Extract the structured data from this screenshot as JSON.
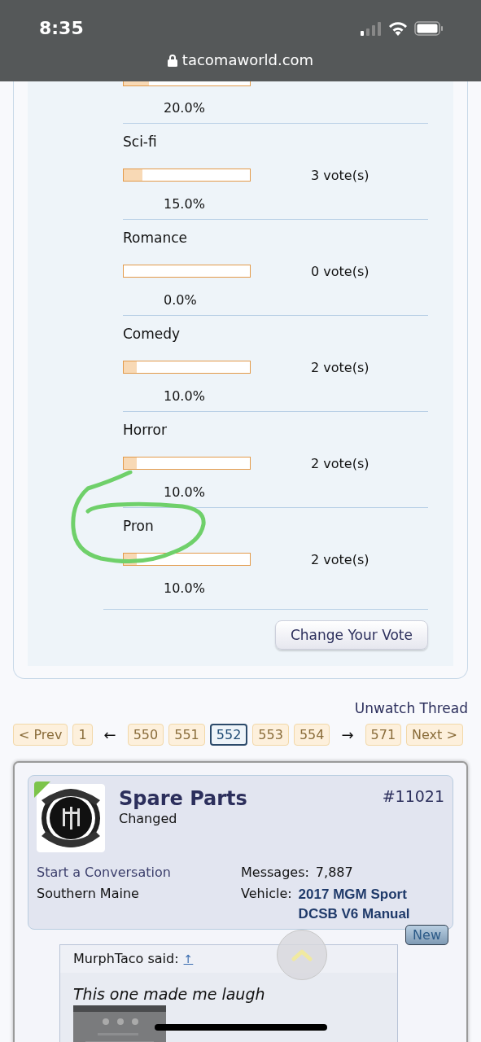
{
  "status_bar": {
    "time": "8:35",
    "url": "tacomaworld.com"
  },
  "poll": {
    "options": [
      {
        "kind": "cut",
        "level": 0.2,
        "percent": "20.0%"
      },
      {
        "kind": "full",
        "label": "Sci-fi",
        "level": 0.15,
        "votes": "3 vote(s)",
        "percent": "15.0%"
      },
      {
        "kind": "full",
        "label": "Romance",
        "level": 0,
        "votes": "0 vote(s)",
        "percent": "0.0%"
      },
      {
        "kind": "full",
        "label": "Comedy",
        "level": 0.1,
        "votes": "2 vote(s)",
        "percent": "10.0%"
      },
      {
        "kind": "full",
        "label": "Horror",
        "level": 0.1,
        "votes": "2 vote(s)",
        "percent": "10.0%"
      },
      {
        "kind": "full",
        "label": "Pron",
        "level": 0.1,
        "votes": "2 vote(s)",
        "percent": "10.0%"
      }
    ],
    "button": "Change Your Vote"
  },
  "unwatch_link": "Unwatch Thread",
  "pagination": [
    {
      "kind": "page",
      "label": "< Prev",
      "selected": false
    },
    {
      "kind": "page",
      "label": "1",
      "selected": false
    },
    {
      "kind": "arrow",
      "label": "←"
    },
    {
      "kind": "page",
      "label": "550",
      "selected": false
    },
    {
      "kind": "page",
      "label": "551",
      "selected": false
    },
    {
      "kind": "page",
      "label": "552",
      "selected": true
    },
    {
      "kind": "page",
      "label": "553",
      "selected": false
    },
    {
      "kind": "page",
      "label": "554",
      "selected": false
    },
    {
      "kind": "arrow",
      "label": "→"
    },
    {
      "kind": "page",
      "label": "571",
      "selected": false
    },
    {
      "kind": "page",
      "label": "Next >",
      "selected": false
    }
  ],
  "post": {
    "username": "Spare Parts",
    "user_title": "Changed",
    "number": "#11021",
    "online": true,
    "conversation_link": "Start a Conversation",
    "location": "Southern Maine",
    "stats": [
      {
        "kind": "plain",
        "label": "Messages:",
        "value": "7,887"
      },
      {
        "kind": "link",
        "label": "Vehicle:",
        "value": "2017 MGM Sport DCSB V6 Manual"
      }
    ],
    "badge": "New",
    "quote": {
      "author": "MurphTaco said:",
      "jump": "↑",
      "text": "This one made me laugh"
    }
  }
}
